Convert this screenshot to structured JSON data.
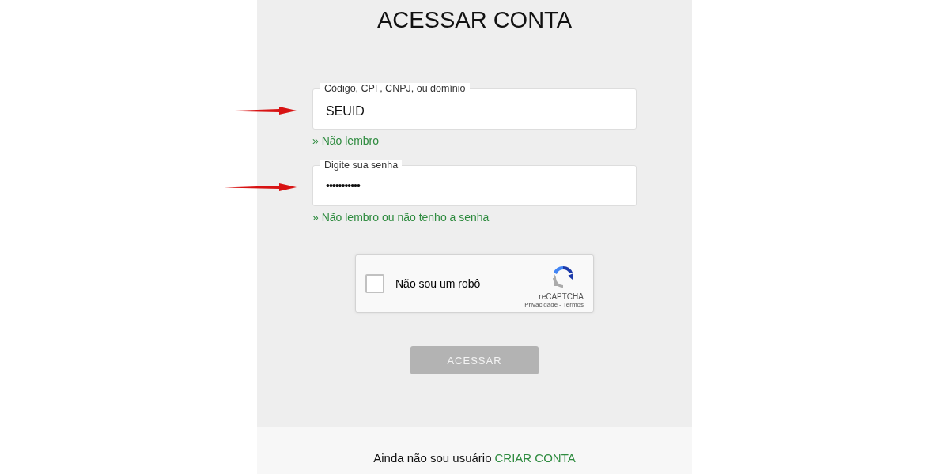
{
  "title": "ACESSAR CONTA",
  "fields": [
    {
      "label": "Código, CPF, CNPJ, ou domínio",
      "value": "SEUID",
      "kind": "text",
      "help_link": "» Não lembro",
      "annotated": true
    },
    {
      "label": "Digite sua senha",
      "value": "•••••••••••",
      "kind": "password",
      "help_link": "» Não lembro ou não tenho a senha",
      "annotated": true
    }
  ],
  "captcha": {
    "label": "Não sou um robô",
    "checked": false,
    "brand": "reCAPTCHA",
    "privacy_link": "Privacidade",
    "separator": "-",
    "terms_link": "Termos"
  },
  "submit": {
    "label": "ACESSAR",
    "disabled": true
  },
  "footer": {
    "text": "Ainda não sou usuário",
    "link": "CRIAR CONTA"
  }
}
